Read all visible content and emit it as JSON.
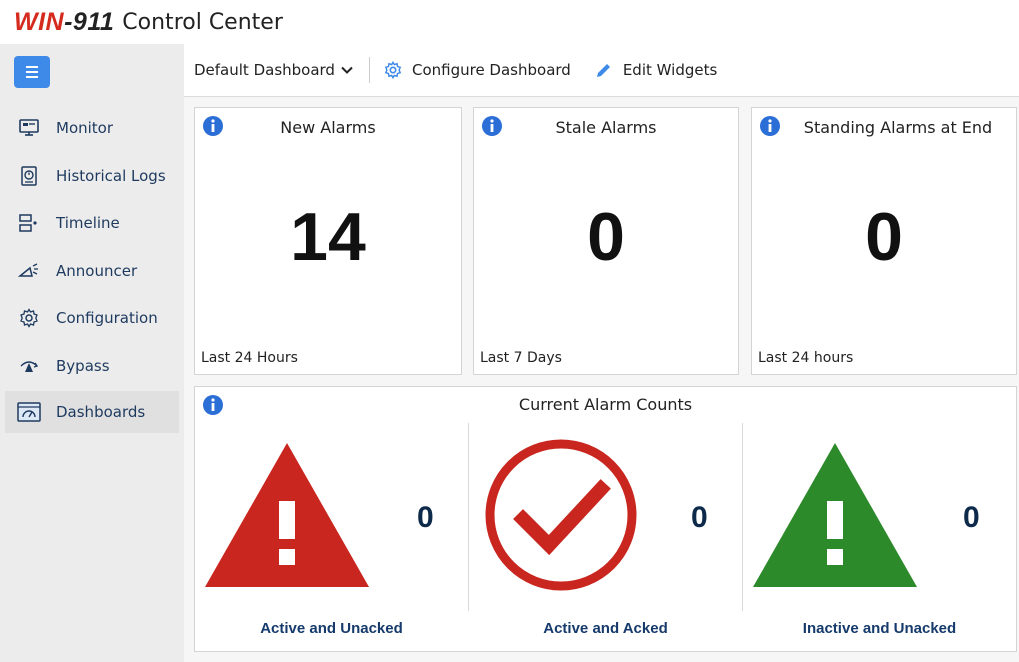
{
  "app": {
    "logo_win": "WIN",
    "logo_num": "-911",
    "title": "Control Center"
  },
  "sidebar": {
    "items": [
      {
        "label": "Monitor",
        "icon": "monitor-icon"
      },
      {
        "label": "Historical Logs",
        "icon": "historical-logs-icon"
      },
      {
        "label": "Timeline",
        "icon": "timeline-icon"
      },
      {
        "label": "Announcer",
        "icon": "announcer-icon"
      },
      {
        "label": "Configuration",
        "icon": "gear-icon"
      },
      {
        "label": "Bypass",
        "icon": "bypass-icon"
      },
      {
        "label": "Dashboards",
        "icon": "dashboard-icon",
        "active": true
      }
    ]
  },
  "toolbar": {
    "dashboard_select": "Default Dashboard",
    "configure_label": "Configure Dashboard",
    "edit_label": "Edit Widgets"
  },
  "widgets": [
    {
      "title": "New Alarms",
      "value": "14",
      "footer": "Last 24 Hours"
    },
    {
      "title": "Stale Alarms",
      "value": "0",
      "footer": "Last 7 Days"
    },
    {
      "title": "Standing Alarms at End",
      "value": "0",
      "footer": "Last 24 hours"
    }
  ],
  "counts": {
    "title": "Current Alarm Counts",
    "items": [
      {
        "label": "Active and Unacked",
        "value": "0",
        "icon": "warning-triangle-red-icon"
      },
      {
        "label": "Active and Acked",
        "value": "0",
        "icon": "check-circle-icon"
      },
      {
        "label": "Inactive and Unacked",
        "value": "0",
        "icon": "warning-triangle-green-icon"
      }
    ]
  },
  "colors": {
    "accent": "#3d8ae8",
    "brand_red": "#d52b1e",
    "alarm_red": "#c8261e",
    "ok_green": "#2d8a2b",
    "label_blue": "#153a6b"
  }
}
